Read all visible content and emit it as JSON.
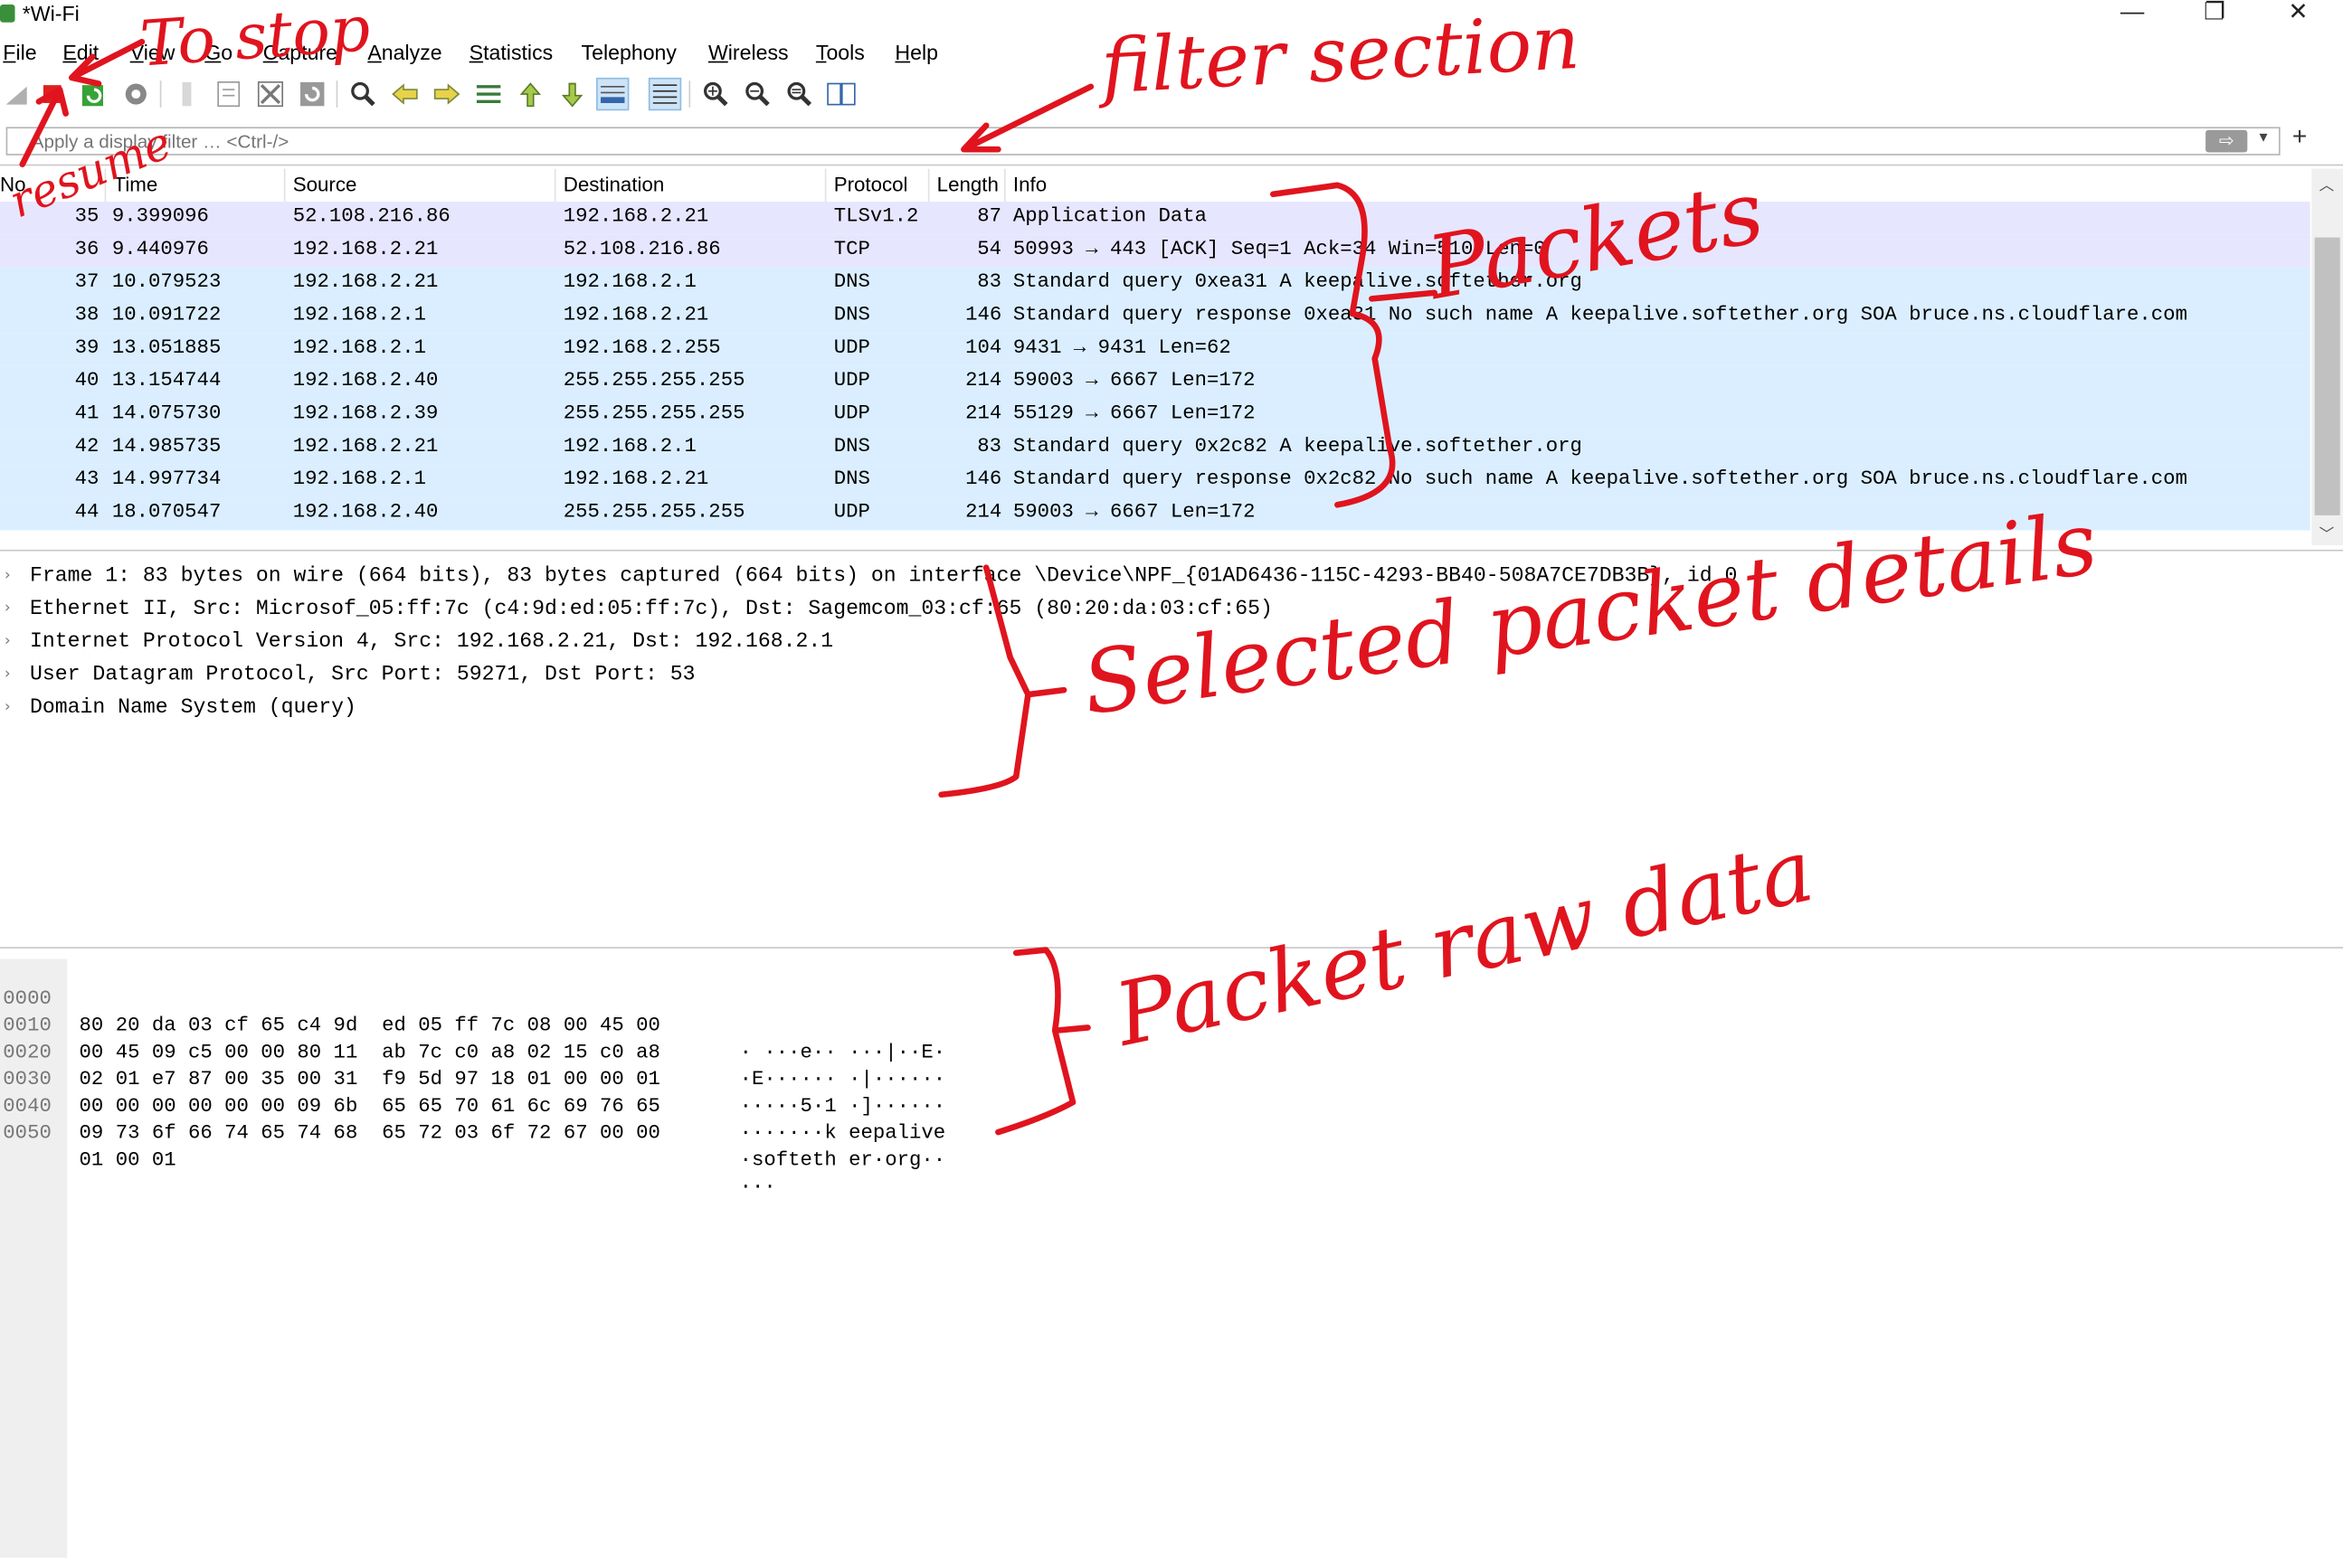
{
  "window": {
    "title": "*Wi-Fi",
    "buttons": {
      "minimize": "—",
      "restore": "❐",
      "close": "✕"
    }
  },
  "menu": [
    {
      "label": "File",
      "accel": "F",
      "rest": "ile"
    },
    {
      "label": "Edit",
      "accel": "E",
      "rest": "dit"
    },
    {
      "label": "View",
      "accel": "V",
      "rest": "iew"
    },
    {
      "label": "Go",
      "accel": "G",
      "rest": "o"
    },
    {
      "label": "Capture",
      "accel": "C",
      "rest": "apture"
    },
    {
      "label": "Analyze",
      "accel": "A",
      "rest": "nalyze"
    },
    {
      "label": "Statistics",
      "accel": "S",
      "rest": "tatistics"
    },
    {
      "label": "Telephony",
      "accel": "",
      "rest": "Telephony"
    },
    {
      "label": "Wireless",
      "accel": "W",
      "rest": "ireless"
    },
    {
      "label": "Tools",
      "accel": "T",
      "rest": "ools"
    },
    {
      "label": "Help",
      "accel": "H",
      "rest": "elp"
    }
  ],
  "toolbar": {
    "icons": [
      "shark-fin-icon",
      "stop-capture-icon",
      "restart-capture-icon",
      "capture-options-icon",
      "open-file-icon",
      "save-file-icon",
      "close-file-icon",
      "reload-file-icon",
      "find-packet-icon",
      "go-back-icon",
      "go-forward-icon",
      "go-to-packet-icon",
      "first-packet-icon",
      "last-packet-icon",
      "autoscroll-icon",
      "colorize-icon",
      "zoom-in-icon",
      "zoom-out-icon",
      "normal-size-icon",
      "resize-columns-icon"
    ],
    "colors": {
      "stop": "#e02020",
      "restart": "#36a336"
    }
  },
  "filter": {
    "placeholder": "Apply a display filter … <Ctrl-/>",
    "apply_label": "⇨",
    "dropdown": "▾",
    "add": "+"
  },
  "packet_list": {
    "columns": [
      "No.",
      "Time",
      "Source",
      "Destination",
      "Protocol",
      "Length",
      "Info"
    ],
    "rows": [
      {
        "no": "35",
        "time": "9.399096",
        "src": "52.108.216.86",
        "dst": "192.168.2.21",
        "proto": "TLSv1.2",
        "len": "87",
        "info": "Application Data"
      },
      {
        "no": "36",
        "time": "9.440976",
        "src": "192.168.2.21",
        "dst": "52.108.216.86",
        "proto": "TCP",
        "len": "54",
        "info": "50993 → 443 [ACK] Seq=1 Ack=34 Win=510 Len=0"
      },
      {
        "no": "37",
        "time": "10.079523",
        "src": "192.168.2.21",
        "dst": "192.168.2.1",
        "proto": "DNS",
        "len": "83",
        "info": "Standard query 0xea31 A keepalive.softether.org"
      },
      {
        "no": "38",
        "time": "10.091722",
        "src": "192.168.2.1",
        "dst": "192.168.2.21",
        "proto": "DNS",
        "len": "146",
        "info": "Standard query response 0xea31 No such name A keepalive.softether.org SOA bruce.ns.cloudflare.com"
      },
      {
        "no": "39",
        "time": "13.051885",
        "src": "192.168.2.1",
        "dst": "192.168.2.255",
        "proto": "UDP",
        "len": "104",
        "info": "9431 → 9431 Len=62"
      },
      {
        "no": "40",
        "time": "13.154744",
        "src": "192.168.2.40",
        "dst": "255.255.255.255",
        "proto": "UDP",
        "len": "214",
        "info": "59003 → 6667 Len=172"
      },
      {
        "no": "41",
        "time": "14.075730",
        "src": "192.168.2.39",
        "dst": "255.255.255.255",
        "proto": "UDP",
        "len": "214",
        "info": "55129 → 6667 Len=172"
      },
      {
        "no": "42",
        "time": "14.985735",
        "src": "192.168.2.21",
        "dst": "192.168.2.1",
        "proto": "DNS",
        "len": "83",
        "info": "Standard query 0x2c82 A keepalive.softether.org"
      },
      {
        "no": "43",
        "time": "14.997734",
        "src": "192.168.2.1",
        "dst": "192.168.2.21",
        "proto": "DNS",
        "len": "146",
        "info": "Standard query response 0x2c82 No such name A keepalive.softether.org SOA bruce.ns.cloudflare.com"
      },
      {
        "no": "44",
        "time": "18.070547",
        "src": "192.168.2.40",
        "dst": "255.255.255.255",
        "proto": "UDP",
        "len": "214",
        "info": "59003 → 6667 Len=172"
      }
    ],
    "row_colors": {
      "TLSv1.2": "#e7e6ff",
      "TCP": "#e7e6ff",
      "DNS": "#daeeff",
      "UDP": "#daeeff"
    }
  },
  "details": [
    "Frame 1: 83 bytes on wire (664 bits), 83 bytes captured (664 bits) on interface \\Device\\NPF_{01AD6436-115C-4293-BB40-508A7CE7DB3B}, id 0",
    "Ethernet II, Src: Microsof_05:ff:7c (c4:9d:ed:05:ff:7c), Dst: Sagemcom_03:cf:65 (80:20:da:03:cf:65)",
    "Internet Protocol Version 4, Src: 192.168.2.21, Dst: 192.168.2.1",
    "User Datagram Protocol, Src Port: 59271, Dst Port: 53",
    "Domain Name System (query)"
  ],
  "bytes": [
    {
      "offset": "0000",
      "hex": "80 20 da 03 cf 65 c4 9d  ed 05 ff 7c 08 00 45 00",
      "ascii": "· ···e·· ···|··E·"
    },
    {
      "offset": "0010",
      "hex": "00 45 09 c5 00 00 80 11  ab 7c c0 a8 02 15 c0 a8",
      "ascii": "·E······ ·|······"
    },
    {
      "offset": "0020",
      "hex": "02 01 e7 87 00 35 00 31  f9 5d 97 18 01 00 00 01",
      "ascii": "·····5·1 ·]······"
    },
    {
      "offset": "0030",
      "hex": "00 00 00 00 00 00 09 6b  65 65 70 61 6c 69 76 65",
      "ascii": "·······k eepalive"
    },
    {
      "offset": "0040",
      "hex": "09 73 6f 66 74 65 74 68  65 72 03 6f 72 67 00 00",
      "ascii": "·softeth er·org··"
    },
    {
      "offset": "0050",
      "hex": "01 00 01",
      "ascii": "···"
    }
  ],
  "annotations": {
    "to_stop": "To stop",
    "resume": "resume",
    "filter_section": "filter section",
    "packets": "Packets",
    "selected_packet_details": "Selected packet details",
    "packet_raw_data": "Packet raw data",
    "color": "#e0141e"
  }
}
